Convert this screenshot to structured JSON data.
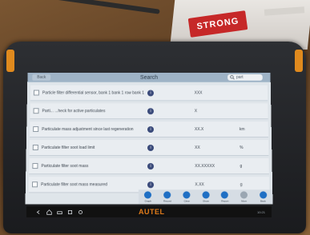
{
  "scene": {
    "box_label": "STRONG"
  },
  "device": {
    "brand": "AUTEL",
    "status_time": "10:21"
  },
  "app": {
    "title": "Search",
    "back_label": "Back",
    "search_value": "part",
    "params": [
      {
        "name": "Particle filter differential sensor, bank 1 bank 1 row bank 1",
        "value": "XXX",
        "unit": ""
      },
      {
        "name": "Parti... ...heck for active particulates",
        "value": "X",
        "unit": ""
      },
      {
        "name": "Particulate mass adjustment since last regeneration",
        "value": "XX.X",
        "unit": "km"
      },
      {
        "name": "Particulate filter soot load limit",
        "value": "XX",
        "unit": "%"
      },
      {
        "name": "Particulate filter soot mass",
        "value": "XX.XXXXX",
        "unit": "g"
      },
      {
        "name": "Particulate filter soot mass measured",
        "value": "X.XX",
        "unit": "g"
      }
    ],
    "toolbar": [
      {
        "icon": "graph-icon",
        "label": "Graph"
      },
      {
        "icon": "record-icon",
        "label": "Record"
      },
      {
        "icon": "clear-icon",
        "label": "Clear"
      },
      {
        "icon": "show-icon",
        "label": "Show"
      },
      {
        "icon": "report-icon",
        "label": "Report"
      },
      {
        "icon": "more-icon",
        "label": "More"
      },
      {
        "icon": "back-icon",
        "label": "Back"
      }
    ]
  },
  "colors": {
    "screen_bg": "#dfe5ea",
    "titlebar": "#9eb3c6",
    "accent_blue": "#1f6fc4",
    "brand_orange": "#e07b1a",
    "device_button": "#e08a1e"
  }
}
